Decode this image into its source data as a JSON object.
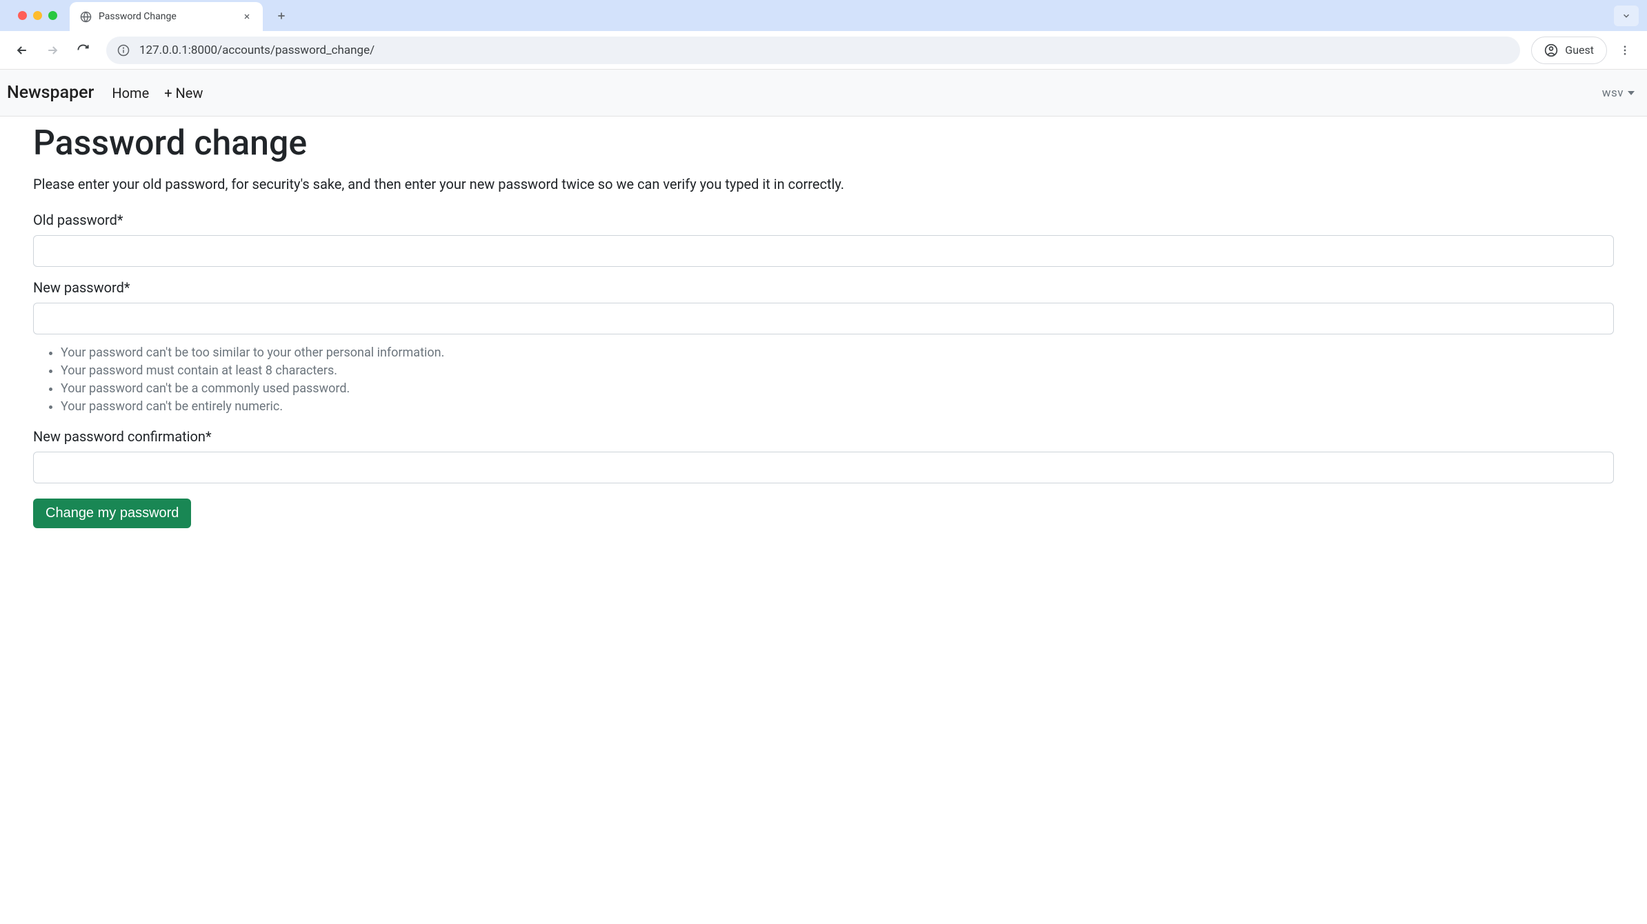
{
  "browser": {
    "tab_title": "Password Change",
    "url": "127.0.0.1:8000/accounts/password_change/",
    "profile_label": "Guest"
  },
  "nav": {
    "brand": "Newspaper",
    "links": {
      "home": "Home",
      "new": "+ New"
    },
    "user_name": "wsv"
  },
  "page": {
    "title": "Password change",
    "instruction": "Please enter your old password, for security's sake, and then enter your new password twice so we can verify you typed it in correctly.",
    "fields": {
      "old_password_label": "Old password*",
      "new_password_label": "New password*",
      "confirm_label": "New password confirmation*",
      "old_password_value": "",
      "new_password_value": "",
      "confirm_value": ""
    },
    "hints": [
      "Your password can't be too similar to your other personal information.",
      "Your password must contain at least 8 characters.",
      "Your password can't be a commonly used password.",
      "Your password can't be entirely numeric."
    ],
    "submit_label": "Change my password"
  }
}
